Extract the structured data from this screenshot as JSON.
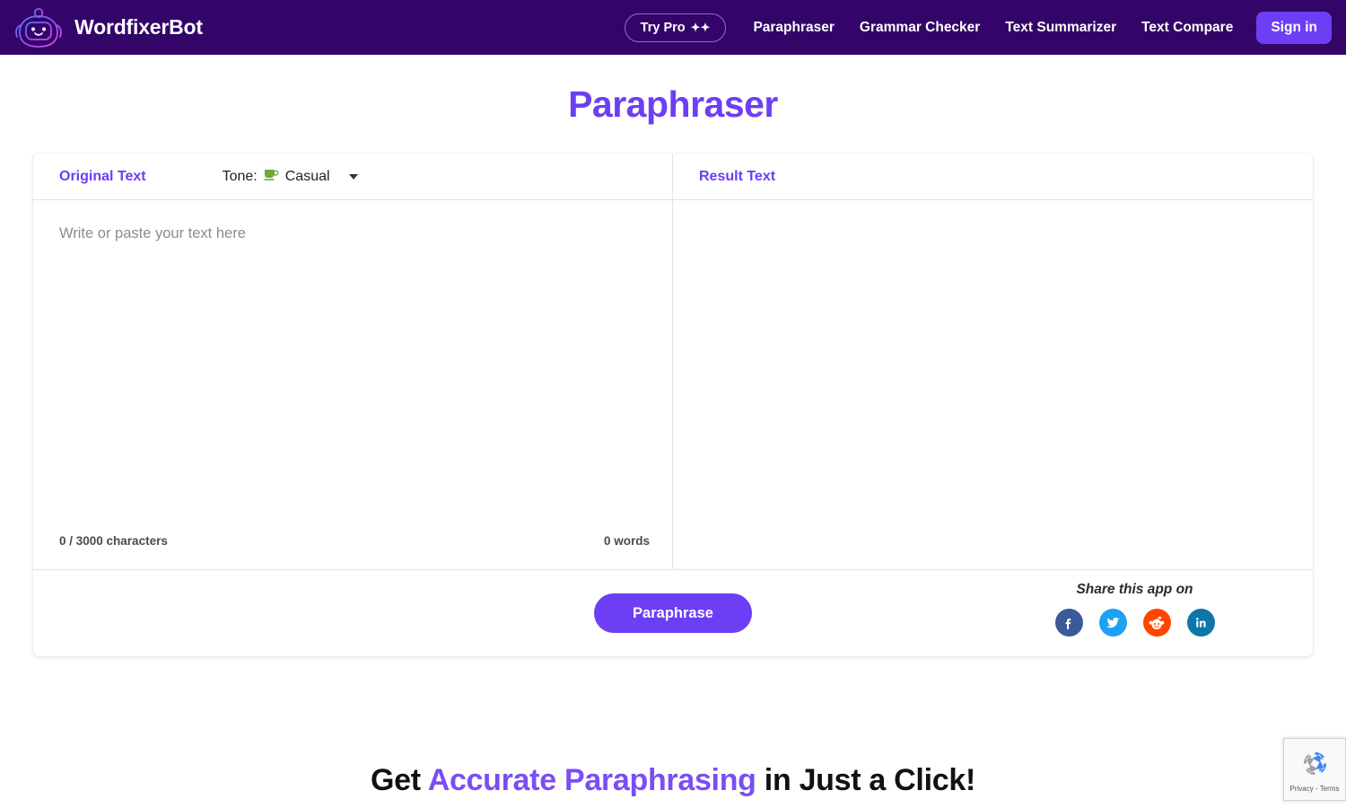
{
  "header": {
    "brand_name": "WordfixerBot",
    "brand_icon": "robot-head-icon",
    "try_pro_label": "Try Pro",
    "try_pro_icon": "sparkles-icon",
    "nav_links": [
      {
        "label": "Paraphraser"
      },
      {
        "label": "Grammar Checker"
      },
      {
        "label": "Text Summarizer"
      },
      {
        "label": "Text Compare"
      }
    ],
    "signin_label": "Sign in",
    "background_color": "#330569",
    "signin_color": "#6c3ef4"
  },
  "page": {
    "title": "Paraphraser",
    "title_color": "#6c3ef4"
  },
  "editor": {
    "original_label": "Original Text",
    "tone_label": "Tone:",
    "tone_icon": "coffee-cup-icon",
    "tone_value": "Casual",
    "caret_icon": "chevron-down-icon",
    "placeholder": "Write or paste your text here",
    "char_count": "0 / 3000 characters",
    "word_count": "0 words"
  },
  "result": {
    "label": "Result Text",
    "content": ""
  },
  "actions": {
    "paraphrase_label": "Paraphrase",
    "paraphrase_color": "#6c3ef4"
  },
  "share": {
    "title": "Share this app on",
    "networks": [
      {
        "name": "facebook",
        "icon": "facebook-icon",
        "color": "#3b5a9a"
      },
      {
        "name": "twitter",
        "icon": "twitter-icon",
        "color": "#1da1f2"
      },
      {
        "name": "reddit",
        "icon": "reddit-icon",
        "color": "#ff4500"
      },
      {
        "name": "linkedin",
        "icon": "linkedin-icon",
        "color": "#0e76a8"
      }
    ]
  },
  "promo": {
    "prefix": "Get ",
    "accent": "Accurate Paraphrasing",
    "suffix": " in Just a Click!",
    "accent_color": "#7b4df5"
  },
  "recaptcha": {
    "icon": "recaptcha-icon",
    "text": "Privacy - Terms"
  }
}
